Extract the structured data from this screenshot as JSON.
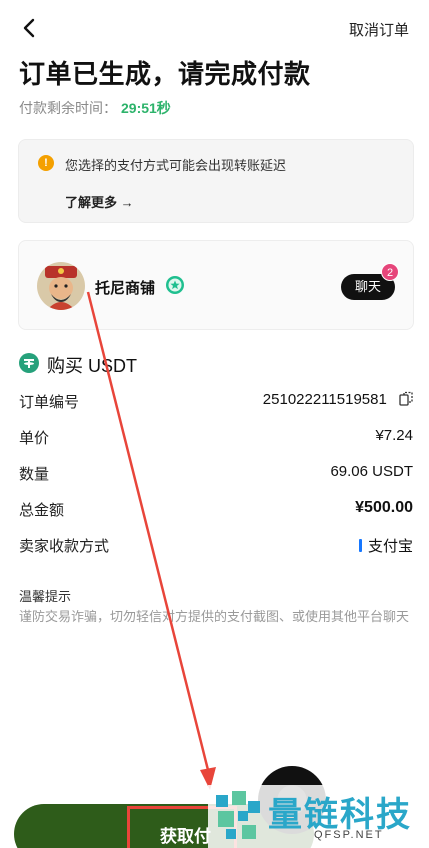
{
  "header": {
    "cancel_label": "取消订单",
    "title": "订单已生成，请完成付款",
    "timer_label": "付款剩余时间：",
    "timer_value": "29:51秒"
  },
  "notice": {
    "message": "您选择的支付方式可能会出现转账延迟",
    "more_label": "了解更多 →"
  },
  "seller": {
    "name": "托尼商铺",
    "chat_label": "聊天",
    "unread_count": "2"
  },
  "order": {
    "heading": "购买 USDT",
    "rows": [
      {
        "label": "订单编号",
        "value": "251022211519581"
      },
      {
        "label": "单价",
        "value": "¥7.24"
      },
      {
        "label": "数量",
        "value": "69.06 USDT"
      },
      {
        "label": "总金额",
        "value": "¥500.00"
      },
      {
        "label": "卖家收款方式",
        "value": "支付宝"
      }
    ]
  },
  "tips": {
    "title": "温馨提示",
    "body": "谨防交易诈骗，切勿轻信对方提供的支付截图、或使用其他平台聊天"
  },
  "bottom": {
    "button_label": "获取付"
  },
  "watermark": {
    "title": "量链科技",
    "subtitle": "QFSP.NET"
  },
  "colors": {
    "timer": "#2db36b",
    "chat_bg": "#111111",
    "badge": "#e6457a",
    "annotation": "#e8453a",
    "button": "#2e5c1a",
    "alipay": "#1677ff"
  }
}
